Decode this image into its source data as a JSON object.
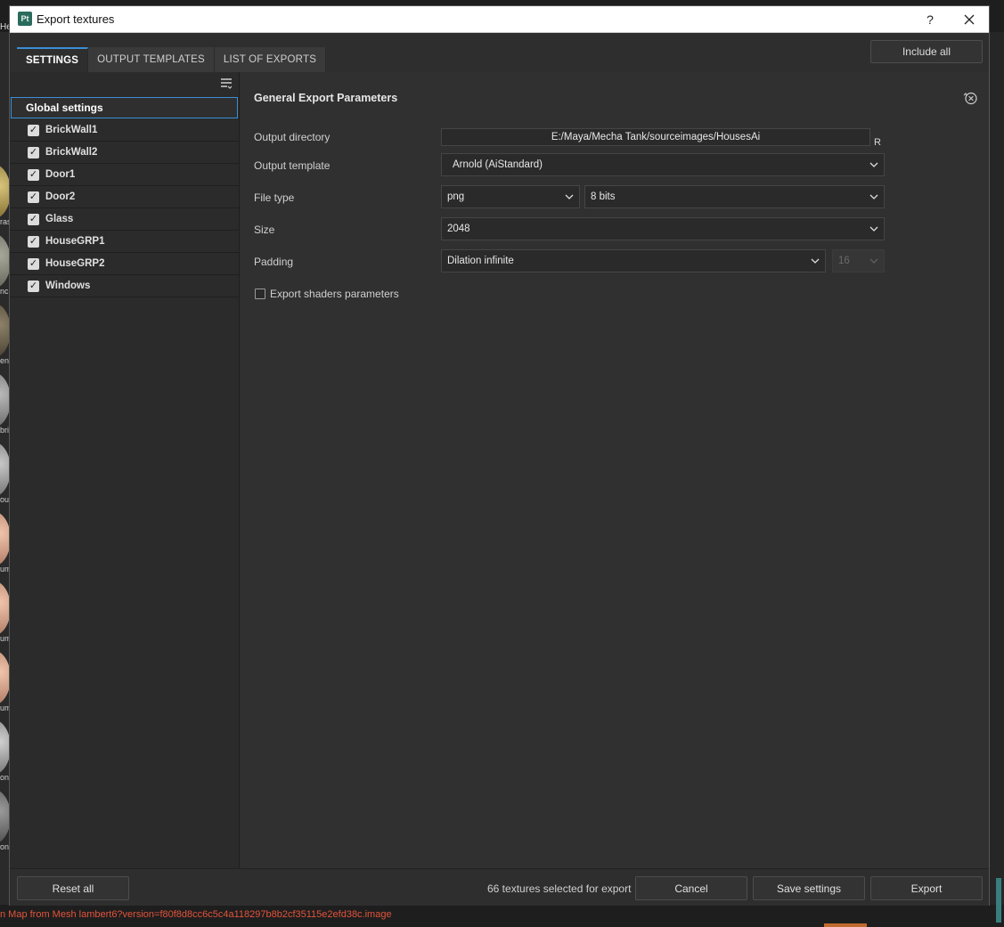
{
  "window": {
    "title": "Export textures",
    "help_label": "?",
    "close_label": "✕",
    "app_icon_text": "Pt"
  },
  "tabs": [
    {
      "label": "SETTINGS",
      "active": true
    },
    {
      "label": "OUTPUT TEMPLATES",
      "active": false
    },
    {
      "label": "LIST OF EXPORTS",
      "active": false
    }
  ],
  "include_all_label": "Include all",
  "texture_sets": {
    "global_label": "Global settings",
    "items": [
      {
        "label": "BrickWall1",
        "checked": true
      },
      {
        "label": "BrickWall2",
        "checked": true
      },
      {
        "label": "Door1",
        "checked": true
      },
      {
        "label": "Door2",
        "checked": true
      },
      {
        "label": "Glass",
        "checked": true
      },
      {
        "label": "HouseGRP1",
        "checked": true
      },
      {
        "label": "HouseGRP2",
        "checked": true
      },
      {
        "label": "Windows",
        "checked": true
      }
    ]
  },
  "params": {
    "section_title": "General Export Parameters",
    "output_directory": {
      "label": "Output directory",
      "value": "E:/Maya/Mecha Tank/sourceimages/HousesAi",
      "suffix": "R"
    },
    "output_template": {
      "label": "Output template",
      "value": "Arnold (AiStandard)"
    },
    "file_type": {
      "label": "File type",
      "format": "png",
      "bit_depth": "8 bits"
    },
    "size": {
      "label": "Size",
      "value": "2048"
    },
    "padding": {
      "label": "Padding",
      "value": "Dilation infinite",
      "amount": "16"
    },
    "export_shaders": {
      "label": "Export shaders parameters",
      "checked": false
    }
  },
  "footer": {
    "reset_all": "Reset all",
    "status": "66 textures selected for export",
    "cancel": "Cancel",
    "save_settings": "Save settings",
    "export": "Export"
  },
  "background": {
    "top_left_text": "He",
    "thumb_labels": [
      "ras",
      "nc",
      "eni",
      "bri",
      "ou",
      "um",
      "um",
      "um",
      "on",
      "on"
    ],
    "error_text": "n Map from Mesh lambert6?version=f80f8d8cc6c5c4a118297b8b2cf35115e2efd38c.image"
  },
  "colors": {
    "accent": "#3b8ed6",
    "error": "#e2543b",
    "app_icon": "#2b6b5d"
  }
}
